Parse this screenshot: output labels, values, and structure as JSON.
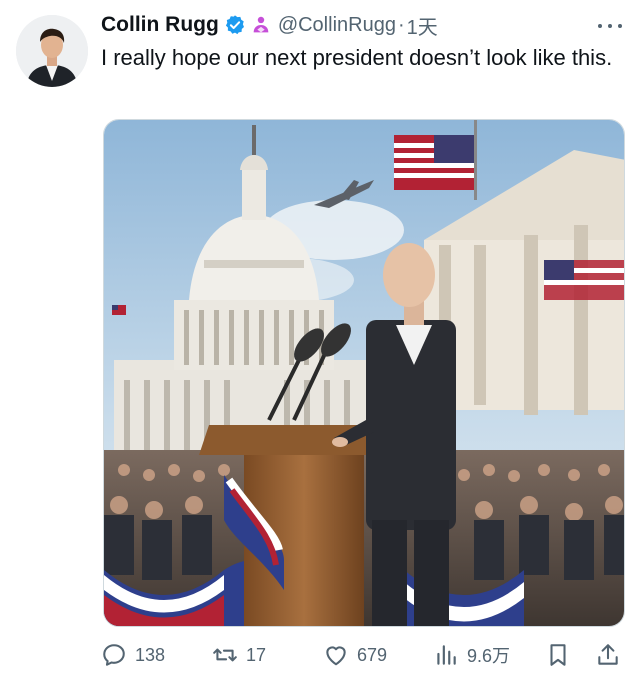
{
  "author": {
    "name": "Collin Rugg",
    "handle": "@CollinRugg",
    "separator": "·",
    "time": "1天"
  },
  "tweet": {
    "text": "I really hope our next president doesn’t look like this."
  },
  "icons": {
    "verified": "verified-badge-icon",
    "affiliate": "affiliate-icon",
    "more": "more-icon",
    "reply": "reply-icon",
    "retweet": "retweet-icon",
    "like": "like-icon",
    "views": "views-icon",
    "bookmark": "bookmark-icon",
    "share": "share-icon"
  },
  "metrics": {
    "replies": "138",
    "retweets": "17",
    "likes": "679",
    "views": "9.6万"
  },
  "colors": {
    "accent": "#1d9bf0",
    "affiliate": "#c64fd8",
    "secondary_text": "#536471",
    "primary_text": "#0f1419"
  }
}
